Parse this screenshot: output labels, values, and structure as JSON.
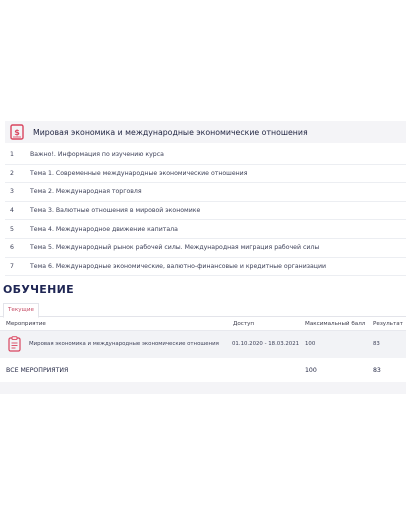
{
  "course": {
    "title": "Мировая экономика и международные экономические отношения",
    "icon": "dollar-document-icon",
    "accent_color": "#d9455f"
  },
  "topics": [
    {
      "num": "1",
      "label": "Важно!. Информация по изучению курса"
    },
    {
      "num": "2",
      "label": "Тема 1. Современные международные экономические отношения"
    },
    {
      "num": "3",
      "label": "Тема 2. Международная торговля"
    },
    {
      "num": "4",
      "label": "Тема 3. Валютные отношения в мировой экономике"
    },
    {
      "num": "5",
      "label": "Тема 4. Международное движение капитала"
    },
    {
      "num": "6",
      "label": "Тема 5. Международный рынок рабочей силы. Международная миграция рабочей силы"
    },
    {
      "num": "7",
      "label": "Тема 6. Международные экономические, валютно-финансовые и кредитные организации"
    }
  ],
  "section_title": "ОБУЧЕНИЕ",
  "tabs": [
    {
      "label": "Текущие"
    }
  ],
  "table": {
    "columns": {
      "event": "Мероприятие",
      "access": "Доступ",
      "max_score": "Максимальный балл",
      "result": "Результат"
    },
    "rows": [
      {
        "icon": "clipboard-icon",
        "event": "Мировая экономика и международные экономические отношения",
        "access": "01.10.2020 - 18.03.2021",
        "max_score": "100",
        "result": "83"
      }
    ],
    "total": {
      "label": "ВСЕ МЕРОПРИЯТИЯ",
      "max_score": "100",
      "result": "83"
    }
  }
}
